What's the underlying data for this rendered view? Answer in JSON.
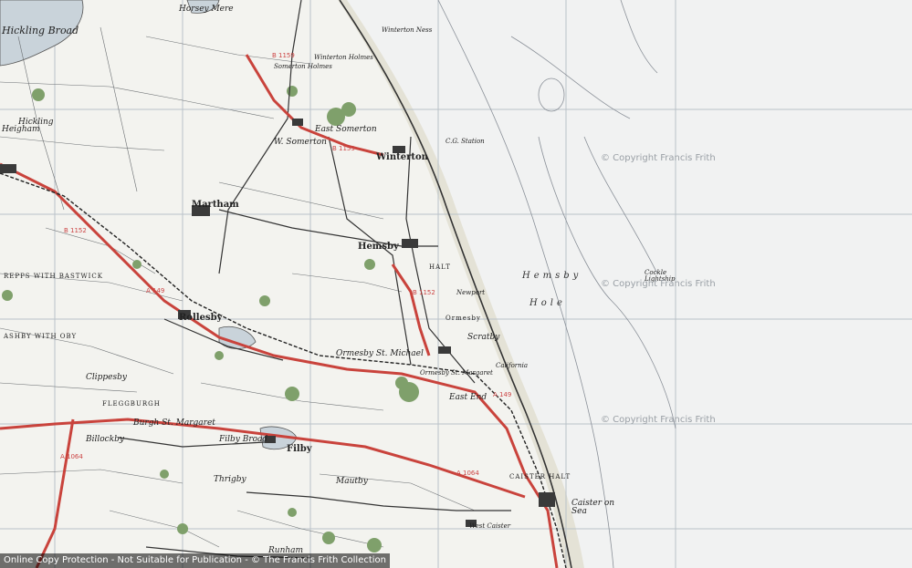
{
  "map": {
    "sea_name_1": "Hemsby",
    "sea_name_2": "Hole",
    "labels": {
      "horsey_mere": "Horsey Mere",
      "hickling_broad": "Hickling Broad",
      "hickling": "Hickling",
      "heigham": "Heigham",
      "winterton_ness": "Winterton Ness",
      "winterton_holmes": "Winterton Holmes",
      "somerton_holmes": "Somerton Holmes",
      "east_somerton": "East Somerton",
      "west_somerton": "W. Somerton",
      "winterton": "Winterton",
      "cg_station": "C.G. Station",
      "martham": "Martham",
      "hemsby": "Hemsby",
      "newport": "Newport",
      "ormesby": "Ormesby",
      "ormesby_st_michael": "Ormesby St. Michael",
      "ormesby_st_margaret": "Ormesby St. Margaret",
      "scratby": "Scratby",
      "california": "California",
      "east_end": "East End",
      "rollesby": "Rollesby",
      "repps": "REPPS WITH BASTWICK",
      "ashby": "ASHBY WITH OBY",
      "clippesby": "Clippesby",
      "fleggburgh": "FLEGGBURGH",
      "billockby": "Billockby",
      "burgh_st_margaret": "Burgh St. Margaret",
      "filby": "Filby",
      "filby_broad": "Filby Broad",
      "thrigby": "Thrigby",
      "mautby": "Mautby",
      "caister": "Caister on Sea",
      "west_caister": "West Caister",
      "runham": "Runham",
      "cockle_lightship": "Cockle Lightship",
      "caister_halt": "CAISTER HALT",
      "hemsby_halt": "HALT"
    },
    "roads": [
      "B 1159",
      "B 1159",
      "A 149",
      "A 149",
      "A 1064",
      "A 1064",
      "B 1152",
      "B 1152"
    ],
    "watermarks": [
      "© Copyright Francis Frith",
      "© Copyright Francis Frith",
      "© Copyright Francis Frith"
    ],
    "footer": "Online Copy Protection - Not Suitable for Publication - © The Francis Frith Collection"
  }
}
